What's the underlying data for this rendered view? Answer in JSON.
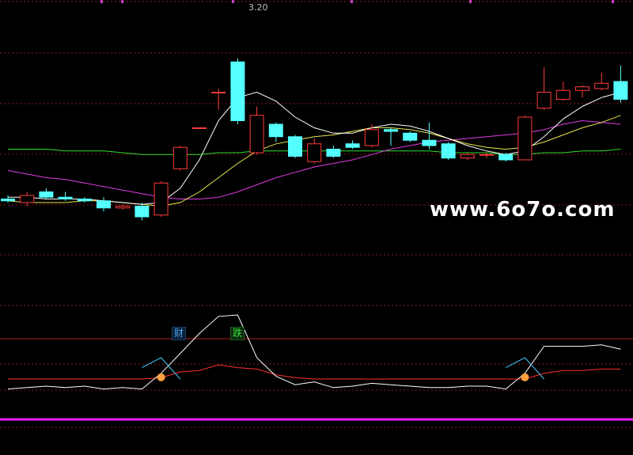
{
  "watermark": "www.6o7o.com",
  "price_label": "3.20",
  "badges": {
    "blue": "财",
    "green": "跌"
  },
  "colors": {
    "up": "#ff3b3b",
    "down": "#54ffff",
    "ma_white": "#ffffff",
    "ma_yellow": "#e8e84a",
    "ma_magenta": "#e03ce0",
    "ma_green": "#2ee02e",
    "grid": "#8a1a1a",
    "baseline": "#ff22ff",
    "ind_white": "#ffffff",
    "ind_red": "#ff3030",
    "ind_cyan": "#40c8ff",
    "marker": "#ffa040"
  },
  "chart_data": {
    "type": "candlestick",
    "main_ylim": [
      0,
      100
    ],
    "candles": [
      {
        "o": 66,
        "c": 65,
        "h": 68,
        "l": 64
      },
      {
        "o": 64,
        "c": 68,
        "h": 70,
        "l": 62
      },
      {
        "o": 70,
        "c": 67,
        "h": 72,
        "l": 66
      },
      {
        "o": 67,
        "c": 66,
        "h": 70,
        "l": 65
      },
      {
        "o": 66,
        "c": 65,
        "h": 67,
        "l": 64
      },
      {
        "o": 65,
        "c": 61,
        "h": 67,
        "l": 59
      },
      {
        "o": 61,
        "c": 62,
        "h": 63,
        "l": 60
      },
      {
        "o": 62,
        "c": 56,
        "h": 64,
        "l": 54
      },
      {
        "o": 57,
        "c": 75,
        "h": 76,
        "l": 56
      },
      {
        "o": 83,
        "c": 95,
        "h": 96,
        "l": 82
      },
      {
        "o": 106,
        "c": 106,
        "h": 106,
        "l": 106
      },
      {
        "o": 126,
        "c": 126,
        "h": 128,
        "l": 116
      },
      {
        "o": 143,
        "c": 110,
        "h": 145,
        "l": 108
      },
      {
        "o": 92,
        "c": 113,
        "h": 118,
        "l": 91
      },
      {
        "o": 108,
        "c": 101,
        "h": 109,
        "l": 98
      },
      {
        "o": 101,
        "c": 90,
        "h": 102,
        "l": 89
      },
      {
        "o": 87,
        "c": 97,
        "h": 100,
        "l": 86
      },
      {
        "o": 94,
        "c": 90,
        "h": 96,
        "l": 89
      },
      {
        "o": 97,
        "c": 95,
        "h": 99,
        "l": 94
      },
      {
        "o": 96,
        "c": 105,
        "h": 108,
        "l": 95
      },
      {
        "o": 105,
        "c": 104,
        "h": 106,
        "l": 96
      },
      {
        "o": 103,
        "c": 99,
        "h": 104,
        "l": 98
      },
      {
        "o": 99,
        "c": 96,
        "h": 109,
        "l": 94
      },
      {
        "o": 97,
        "c": 89,
        "h": 98,
        "l": 88
      },
      {
        "o": 89,
        "c": 91,
        "h": 92,
        "l": 88
      },
      {
        "o": 91,
        "c": 91,
        "h": 92,
        "l": 89
      },
      {
        "o": 91,
        "c": 88,
        "h": 92,
        "l": 87
      },
      {
        "o": 88,
        "c": 112,
        "h": 113,
        "l": 88
      },
      {
        "o": 117,
        "c": 126,
        "h": 140,
        "l": 116
      },
      {
        "o": 122,
        "c": 127,
        "h": 132,
        "l": 121
      },
      {
        "o": 127,
        "c": 129,
        "h": 130,
        "l": 123
      },
      {
        "o": 128,
        "c": 131,
        "h": 137,
        "l": 127
      },
      {
        "o": 132,
        "c": 122,
        "h": 141,
        "l": 120
      }
    ],
    "ma_white": [
      67,
      67,
      66,
      66,
      66,
      65,
      64,
      63,
      64,
      72,
      88,
      110,
      123,
      126,
      121,
      112,
      106,
      103,
      103,
      106,
      108,
      107,
      104,
      100,
      96,
      93,
      91,
      93,
      101,
      111,
      118,
      123,
      126
    ],
    "ma_yellow": [
      65,
      64,
      64,
      64,
      65,
      65,
      64,
      63,
      62,
      64,
      70,
      78,
      86,
      93,
      97,
      99,
      101,
      102,
      104,
      106,
      106,
      105,
      103,
      100,
      97,
      95,
      94,
      95,
      98,
      102,
      106,
      109,
      113
    ],
    "ma_magenta": [
      82,
      80,
      78,
      77,
      75,
      73,
      71,
      69,
      67,
      66,
      66,
      67,
      70,
      74,
      78,
      81,
      84,
      86,
      88,
      91,
      94,
      96,
      98,
      99,
      100,
      101,
      102,
      103,
      105,
      108,
      110,
      109,
      108
    ],
    "ma_green": [
      94,
      94,
      94,
      93,
      93,
      93,
      92,
      91,
      91,
      91,
      91,
      92,
      92,
      93,
      93,
      93,
      93,
      93,
      93,
      93,
      93,
      93,
      93,
      92,
      92,
      92,
      91,
      91,
      92,
      92,
      93,
      93,
      94
    ],
    "ind_white": [
      38,
      39,
      40,
      39,
      40,
      38,
      39,
      38,
      49,
      63,
      77,
      89,
      90,
      60,
      47,
      41,
      43,
      39,
      40,
      42,
      41,
      40,
      39,
      39,
      40,
      40,
      38,
      49,
      68,
      68,
      68,
      69,
      66
    ],
    "ind_red": [
      45,
      45,
      45,
      45,
      45,
      45,
      45,
      45,
      46,
      50,
      51,
      55,
      53,
      52,
      48,
      46,
      45,
      45,
      45,
      45,
      45,
      45,
      45,
      45,
      45,
      45,
      45,
      45,
      49,
      51,
      51,
      52,
      52
    ],
    "ind_cyan": [
      null,
      null,
      null,
      null,
      null,
      null,
      null,
      53,
      60,
      45,
      null,
      null,
      null,
      null,
      null,
      null,
      null,
      null,
      null,
      null,
      null,
      null,
      null,
      null,
      null,
      null,
      53,
      60,
      45,
      null,
      null,
      null,
      null
    ],
    "markers": [
      8,
      27
    ]
  }
}
